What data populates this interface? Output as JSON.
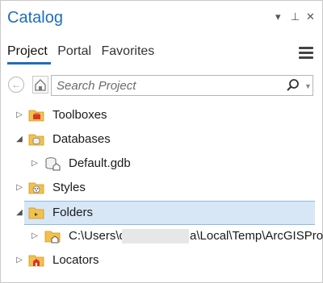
{
  "window": {
    "title": "Catalog",
    "controls": [
      "▾",
      "⊥",
      "✕"
    ]
  },
  "tabs": [
    {
      "label": "Project",
      "active": true
    },
    {
      "label": "Portal",
      "active": false
    },
    {
      "label": "Favorites",
      "active": false
    }
  ],
  "search": {
    "placeholder": "Search Project"
  },
  "tree": [
    {
      "label": "Toolboxes",
      "expanded": false,
      "icon": "toolbox-folder-icon"
    },
    {
      "label": "Databases",
      "expanded": true,
      "icon": "database-folder-icon"
    },
    {
      "label": "Default.gdb",
      "expanded": false,
      "icon": "geodatabase-home-icon",
      "indent": 1
    },
    {
      "label": "Styles",
      "expanded": false,
      "icon": "styles-folder-icon"
    },
    {
      "label": "Folders",
      "expanded": true,
      "icon": "folder-icon",
      "selected": true
    },
    {
      "label": "C:\\Users\\d",
      "label_suffix": "a\\Local\\Temp\\ArcGISPro",
      "expanded": false,
      "icon": "folder-home-icon",
      "indent": 1,
      "redacted": true
    },
    {
      "label": "Locators",
      "expanded": false,
      "icon": "locators-folder-icon"
    }
  ],
  "colors": {
    "accent": "#1e6fb8",
    "selection": "#d8e7f6",
    "folder": "#f3c14b"
  }
}
